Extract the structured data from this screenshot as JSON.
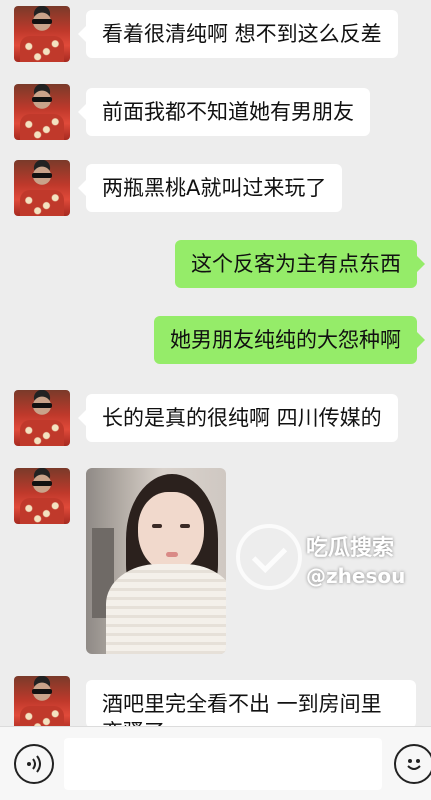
{
  "messages": [
    {
      "side": "left",
      "text": "看着很清纯啊 想不到这么反差"
    },
    {
      "side": "left",
      "text": "前面我都不知道她有男朋友"
    },
    {
      "side": "left",
      "text": "两瓶黑桃A就叫过来玩了"
    },
    {
      "side": "right",
      "text": "这个反客为主有点东西"
    },
    {
      "side": "right",
      "text": "她男朋友纯纯的大怨种啊"
    },
    {
      "side": "left",
      "text": "长的是真的很纯啊  四川传媒的"
    },
    {
      "side": "left",
      "type": "image"
    },
    {
      "side": "left",
      "text": "酒吧里完全看不出 一到房间里变骚了"
    }
  ],
  "watermark": {
    "name": "吃瓜搜索",
    "handle": "@zhesou"
  },
  "input_bar": {
    "voice_icon": "voice-icon",
    "emoji_icon": "emoji-icon"
  },
  "colors": {
    "background": "#ededed",
    "bubble_left": "#ffffff",
    "bubble_right": "#95ec69"
  }
}
